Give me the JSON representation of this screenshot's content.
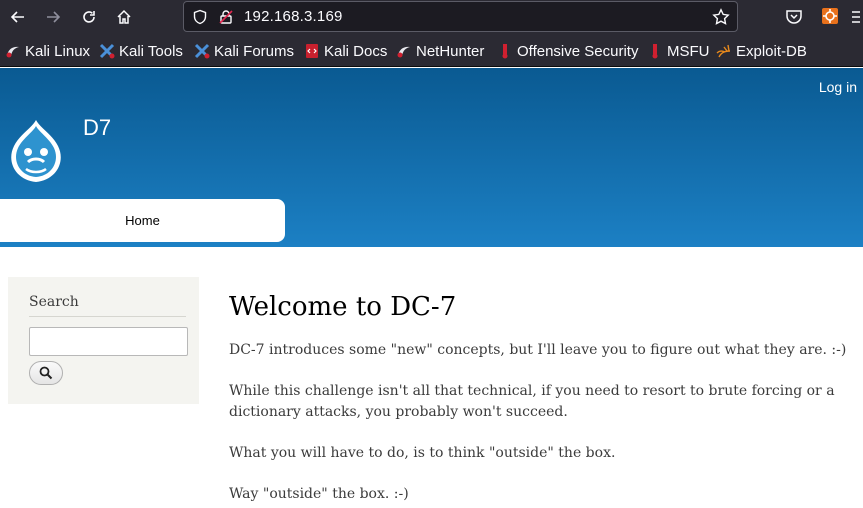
{
  "browser": {
    "url": "192.168.3.169",
    "bookmarks": [
      {
        "label": "Kali Linux",
        "icon": "kali-dragon-icon"
      },
      {
        "label": "Kali Tools",
        "icon": "kali-tools-icon"
      },
      {
        "label": "Kali Forums",
        "icon": "kali-forums-icon"
      },
      {
        "label": "Kali Docs",
        "icon": "kali-docs-icon"
      },
      {
        "label": "NetHunter",
        "icon": "nethunter-icon"
      },
      {
        "label": "Offensive Security",
        "icon": "offsec-icon"
      },
      {
        "label": "MSFU",
        "icon": "msfu-icon"
      },
      {
        "label": "Exploit-DB",
        "icon": "exploitdb-icon"
      }
    ]
  },
  "site": {
    "login_label": "Log in",
    "name": "D7",
    "menu": {
      "home_label": "Home"
    },
    "header_gradient": [
      "#0a5a92",
      "#1c80c4"
    ]
  },
  "sidebar": {
    "search_title": "Search",
    "search_value": ""
  },
  "content": {
    "title": "Welcome to DC-7",
    "paragraphs": [
      "DC-7 introduces some \"new\" concepts, but I'll leave you to figure out what they are.  :-)",
      "While this challenge isn't all that technical, if you need to resort to brute forcing or a dictionary attacks, you probably won't succeed.",
      "What you will have to do, is to think \"outside\" the box.",
      "Way \"outside\" the box.  :-)"
    ]
  }
}
